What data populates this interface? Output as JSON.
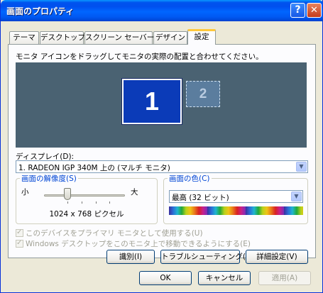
{
  "window": {
    "title": "画面のプロパティ",
    "help_label": "?",
    "close_label": "✕"
  },
  "tabs": [
    {
      "label": "テーマ",
      "active": false
    },
    {
      "label": "デスクトップ",
      "active": false
    },
    {
      "label": "スクリーン セーバー",
      "active": false
    },
    {
      "label": "デザイン",
      "active": false
    },
    {
      "label": "設定",
      "active": true
    }
  ],
  "settings": {
    "instruction": "モニタ アイコンをドラッグしてモニタの実際の配置と合わせてください。",
    "monitors": [
      {
        "number": "1",
        "primary": true
      },
      {
        "number": "2",
        "primary": false
      }
    ],
    "display_label": "ディスプレイ(D):",
    "display_value": "1. RADEON IGP 340M 上の (マルチ モニタ)",
    "resolution": {
      "group_label": "画面の解像度(S)",
      "small_label": "小",
      "large_label": "大",
      "value_text": "1024 x 768 ピクセル",
      "slider_fraction": 0.25
    },
    "color": {
      "group_label": "画面の色(C)",
      "value": "最高 (32 ビット)"
    },
    "checkbox_primary": "このデバイスをプライマリ モニタとして使用する(U)",
    "checkbox_extend": "Windows デスクトップをこのモニタ上で移動できるようにする(E)",
    "identify_button": "識別(I)",
    "troubleshoot_button": "トラブルシューティング(T)...",
    "advanced_button": "詳細設定(V)"
  },
  "footer": {
    "ok": "OK",
    "cancel": "キャンセル",
    "apply": "適用(A)"
  },
  "colors": {
    "titlebar": "#0058f2",
    "preview_bg": "#4a6272",
    "primary_monitor": "#0b3bb8",
    "group_label": "#0046d5"
  }
}
